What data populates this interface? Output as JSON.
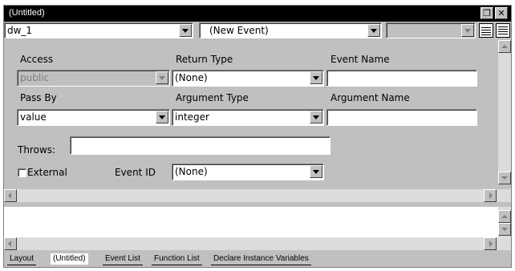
{
  "window": {
    "title": "(Untitled)"
  },
  "toolbar": {
    "object_select": "dw_1",
    "event_select": "(New Event)",
    "third_select": ""
  },
  "labels": {
    "access": "Access",
    "return_type": "Return Type",
    "event_name": "Event Name",
    "pass_by": "Pass By",
    "argument_type": "Argument Type",
    "argument_name": "Argument Name",
    "throws": "Throws:",
    "external": "External",
    "event_id": "Event ID"
  },
  "fields": {
    "access": "public",
    "return_type": "(None)",
    "event_name": "",
    "pass_by": "value",
    "argument_type": "integer",
    "argument_name": "",
    "throws": "",
    "event_id": "(None)"
  },
  "checkboxes": {
    "external_checked": false
  },
  "tabs": [
    "Layout",
    "(Untitled)",
    "Event List",
    "Function List",
    "Declare Instance Variables"
  ],
  "active_tab": "(Untitled)"
}
